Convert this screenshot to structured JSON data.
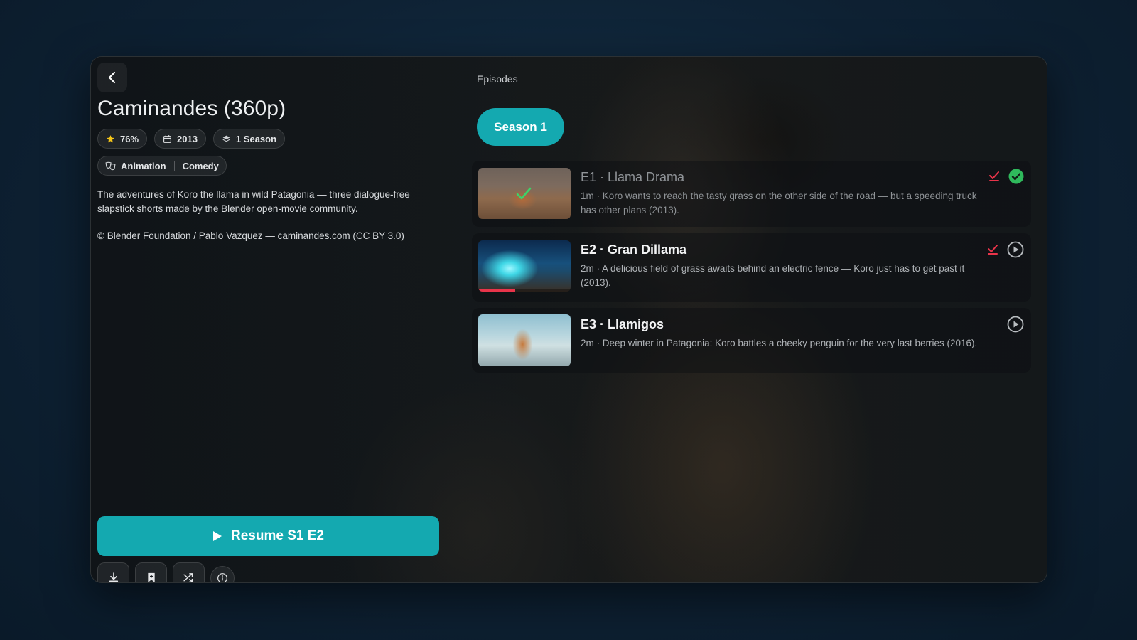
{
  "colors": {
    "accent": "#14a9b0",
    "watched_green": "#2fb95c",
    "mark_red": "#e8344a"
  },
  "header": {
    "back_icon": "chevron-left-icon"
  },
  "show": {
    "title": "Caminandes (360p)",
    "rating": "76%",
    "year": "2013",
    "seasons": "1 Season",
    "genres": [
      "Animation",
      "Comedy"
    ],
    "description": "The adventures of Koro the llama in wild Patagonia — three dialogue-free slapstick shorts made by the Blender open-movie community.",
    "copyright": "© Blender Foundation / Pablo Vazquez — caminandes.com (CC BY 3.0)"
  },
  "actions": {
    "resume_label": "Resume S1 E2",
    "buttons": [
      "download-icon",
      "bookmark-icon",
      "shuffle-icon",
      "info-icon"
    ]
  },
  "episodes_panel": {
    "label": "Episodes",
    "season_tab": "Season 1",
    "episodes": [
      {
        "title": "E1 · Llama Drama",
        "description": "1m · Koro wants to reach the tasty grass on the other side of the road — but a speeding truck has other plans (2013).",
        "watched": true,
        "progress": 1.0
      },
      {
        "title": "E2 · Gran Dillama",
        "description": "2m · A delicious field of grass awaits behind an electric fence — Koro just has to get past it (2013).",
        "watched": false,
        "progress": 0.4
      },
      {
        "title": "E3 · Llamigos",
        "description": "2m · Deep winter in Patagonia: Koro battles a cheeky penguin for the very last berries (2016).",
        "watched": false,
        "progress": 0
      }
    ]
  }
}
